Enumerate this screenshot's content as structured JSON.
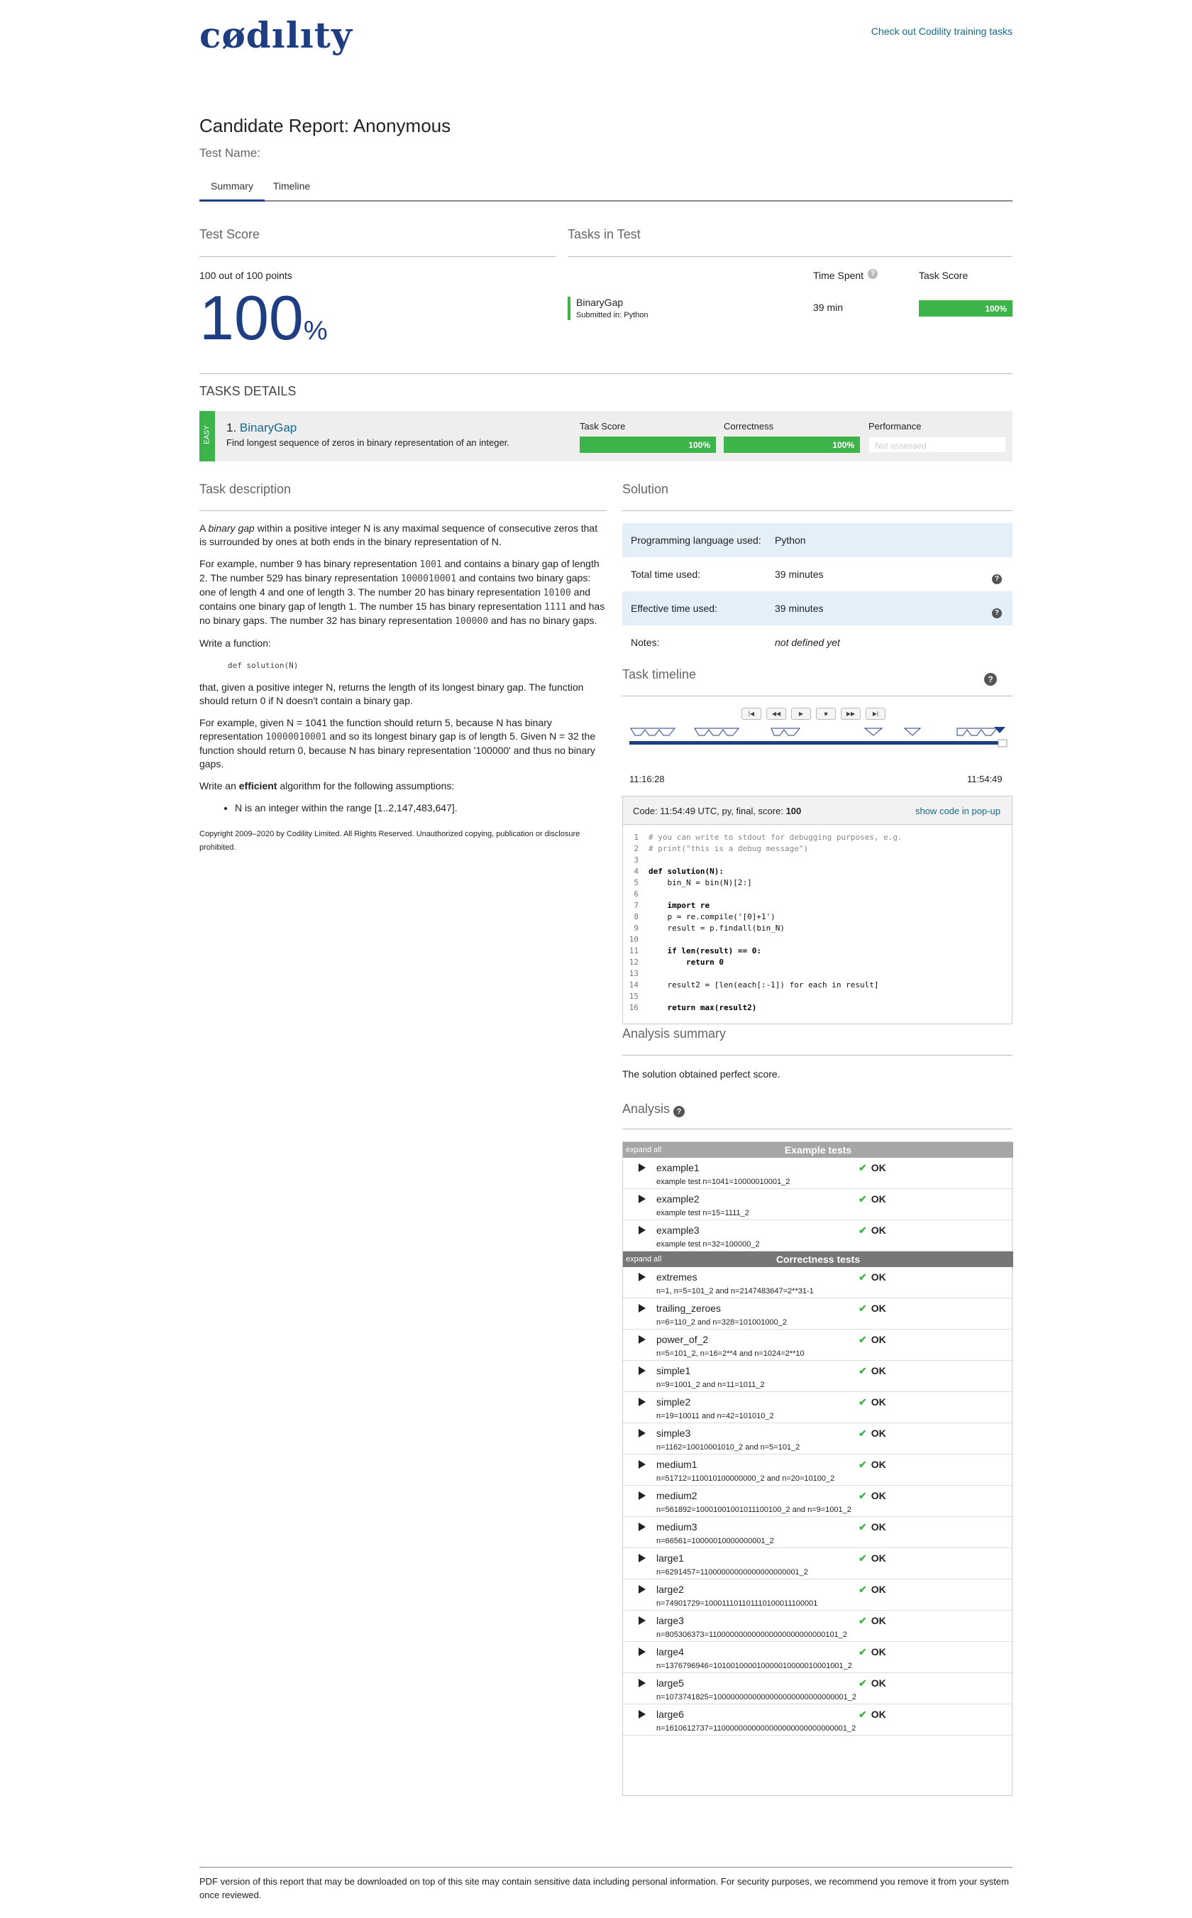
{
  "brand": {
    "logo": "cødılıty",
    "top_link": "Check out Codility training tasks"
  },
  "report": {
    "title": "Candidate Report: Anonymous",
    "test_name_label": "Test Name:"
  },
  "tabs": [
    {
      "label": "Summary",
      "active": true
    },
    {
      "label": "Timeline",
      "active": false
    }
  ],
  "summary": {
    "test_score_heading": "Test Score",
    "points_text": "100 out of 100 points",
    "score_value": "100",
    "score_unit": "%",
    "tasks_heading": "Tasks in Test",
    "time_spent_label": "Time Spent",
    "task_score_label": "Task Score",
    "task_name": "BinaryGap",
    "submitted_in": "Submitted in: Python",
    "time_spent": "39 min",
    "task_score": "100%",
    "task_score_fraction": 1.0
  },
  "details": {
    "heading": "TASKS DETAILS",
    "difficulty": "EASY",
    "task_number": "1.",
    "task_name": "BinaryGap",
    "task_summary": "Find longest sequence of zeros in binary representation of an integer.",
    "task_score_label": "Task Score",
    "task_score": "100%",
    "correctness_label": "Correctness",
    "correctness": "100%",
    "performance_label": "Performance",
    "performance": "Not assessed"
  },
  "description": {
    "heading": "Task description",
    "p1_a": "A ",
    "p1_em": "binary gap",
    "p1_b": " within a positive integer N is any maximal sequence of consecutive zeros that is surrounded by ones at both ends in the binary representation of N.",
    "p2_a": "For example, number 9 has binary representation ",
    "p2_c1": "1001",
    "p2_b": " and contains a binary gap of length 2. The number 529 has binary representation ",
    "p2_c2": "1000010001",
    "p2_c": " and contains two binary gaps: one of length 4 and one of length 3. The number 20 has binary representation ",
    "p2_c3": "10100",
    "p2_d": " and contains one binary gap of length 1. The number 15 has binary representation ",
    "p2_c4": "1111",
    "p2_e": " and has no binary gaps. The number 32 has binary representation ",
    "p2_c5": "100000",
    "p2_f": " and has no binary gaps.",
    "p3": "Write a function:",
    "signature": "def solution(N)",
    "p4": "that, given a positive integer N, returns the length of its longest binary gap. The function should return 0 if N doesn't contain a binary gap.",
    "p5_a": "For example, given N = 1041 the function should return 5, because N has binary representation ",
    "p5_c": "10000010001",
    "p5_b": " and so its longest binary gap is of length 5. Given N = 32 the function should return 0, because N has binary representation '100000' and thus no binary gaps.",
    "p6_a": "Write an ",
    "p6_strong": "efficient",
    "p6_b": " algorithm for the following assumptions:",
    "assumption": "N is an integer within the range [1..2,147,483,647].",
    "copyright": "Copyright 2009–2020 by Codility Limited. All Rights Reserved. Unauthorized copying, publication or disclosure prohibited."
  },
  "solution": {
    "heading": "Solution",
    "lang_label": "Programming language used:",
    "lang": "Python",
    "total_label": "Total time used:",
    "total": "39 minutes",
    "effective_label": "Effective time used:",
    "effective": "39 minutes",
    "notes_label": "Notes:",
    "notes": "not defined yet",
    "timeline_heading": "Task timeline",
    "timeline_start": "11:16:28",
    "timeline_end": "11:54:49",
    "controls": [
      "|◀",
      "◀◀",
      "▶",
      "■",
      "▶▶",
      "▶|"
    ],
    "code_header": "Code: 11:54:49 UTC, py, final, score: ",
    "code_score": "100",
    "popup_link": "show code in pop-up",
    "code": [
      "# you can write to stdout for debugging purposes, e.g.",
      "# print(\"this is a debug message\")",
      "",
      "def solution(N):",
      "    bin_N = bin(N)[2:]",
      "",
      "    import re",
      "    p = re.compile('[0]+1')",
      "    result = p.findall(bin_N)",
      "",
      "    if len(result) == 0:",
      "        return 0",
      "",
      "    result2 = [len(each[:-1]) for each in result]",
      "",
      "    return max(result2)"
    ]
  },
  "analysis_summary": {
    "heading": "Analysis summary",
    "text": "The solution obtained perfect score."
  },
  "analysis": {
    "heading": "Analysis",
    "expand_all": "expand all",
    "example_heading": "Example tests",
    "correctness_heading": "Correctness tests",
    "ok_label": "OK",
    "check": "✔",
    "example_tests": [
      {
        "name": "example1",
        "desc": "example test n=1041=10000010001_2"
      },
      {
        "name": "example2",
        "desc": "example test n=15=1111_2"
      },
      {
        "name": "example3",
        "desc": "example test n=32=100000_2"
      }
    ],
    "correctness_tests": [
      {
        "name": "extremes",
        "desc": "n=1, n=5=101_2 and n=2147483647=2**31-1"
      },
      {
        "name": "trailing_zeroes",
        "desc": "n=6=110_2 and n=328=101001000_2"
      },
      {
        "name": "power_of_2",
        "desc": "n=5=101_2, n=16=2**4 and n=1024=2**10"
      },
      {
        "name": "simple1",
        "desc": "n=9=1001_2 and n=11=1011_2"
      },
      {
        "name": "simple2",
        "desc": "n=19=10011 and n=42=101010_2"
      },
      {
        "name": "simple3",
        "desc": "n=1162=10010001010_2 and n=5=101_2"
      },
      {
        "name": "medium1",
        "desc": "n=51712=110010100000000_2 and n=20=10100_2"
      },
      {
        "name": "medium2",
        "desc": "n=561892=10001001001011100100_2 and n=9=1001_2"
      },
      {
        "name": "medium3",
        "desc": "n=66561=10000010000000001_2"
      },
      {
        "name": "large1",
        "desc": "n=6291457=11000000000000000000001_2"
      },
      {
        "name": "large2",
        "desc": "n=74901729=100011101101110100011100001"
      },
      {
        "name": "large3",
        "desc": "n=805306373=110000000000000000000000000101_2"
      },
      {
        "name": "large4",
        "desc": "n=1376796946=101001000010000010000010001001_2"
      },
      {
        "name": "large5",
        "desc": "n=1073741825=1000000000000000000000000000001_2"
      },
      {
        "name": "large6",
        "desc": "n=1610612737=1100000000000000000000000000001_2"
      }
    ]
  },
  "footer": {
    "text": "PDF version of this report that may be downloaded on top of this site may contain sensitive data including personal information. For security purposes, we recommend you remove it from your system once reviewed."
  },
  "colors": {
    "brand": "#1f3e82",
    "link": "#15698a",
    "score_green": "#3cb44a",
    "example_header": "#a6a6a6",
    "correctness_header": "#777777",
    "highlight_row": "#e3eff9"
  }
}
